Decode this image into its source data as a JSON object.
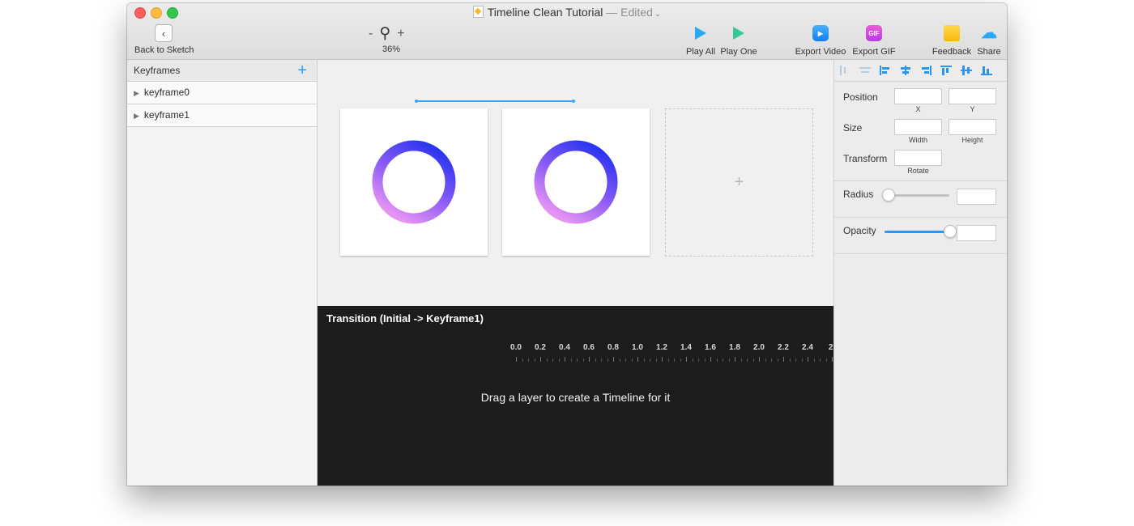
{
  "window": {
    "title": "Timeline Clean Tutorial",
    "edited": "— Edited"
  },
  "toolbar": {
    "back_label": "Back to Sketch",
    "zoom_minus": "-",
    "zoom_plus": "+",
    "zoom_level": "36%",
    "play_all_label": "Play All",
    "play_one_label": "Play One",
    "export_video_label": "Export Video",
    "export_gif_label": "Export GIF",
    "gif_icon_text": "GIF",
    "feedback_label": "Feedback",
    "share_label": "Share"
  },
  "sidebar": {
    "header": "Keyframes",
    "items": [
      {
        "label": "keyframe0"
      },
      {
        "label": "keyframe1"
      }
    ]
  },
  "canvas": {
    "empty_slot_symbol": "+",
    "ring_gradient": [
      "#1d2ef0",
      "#8a5cf6",
      "#e793f3"
    ]
  },
  "timeline": {
    "title": "Transition (Initial -> Keyframe1)",
    "ticks": [
      "0.0",
      "0.2",
      "0.4",
      "0.6",
      "0.8",
      "1.0",
      "1.2",
      "1.4",
      "1.6",
      "1.8",
      "2.0",
      "2.2",
      "2.4",
      "2."
    ],
    "empty_message": "Drag a layer to create a Timeline for it"
  },
  "inspector": {
    "position_label": "Position",
    "x_label": "X",
    "y_label": "Y",
    "size_label": "Size",
    "width_label": "Width",
    "height_label": "Height",
    "transform_label": "Transform",
    "rotate_label": "Rotate",
    "radius_label": "Radius",
    "radius_slider_value": 0,
    "opacity_label": "Opacity",
    "opacity_slider_value": 1.0
  },
  "colors": {
    "accent": "#2d96f0",
    "play_all": "#2aa9f1",
    "play_one": "#36c79a",
    "timeline_bg": "#1c1c1c"
  }
}
